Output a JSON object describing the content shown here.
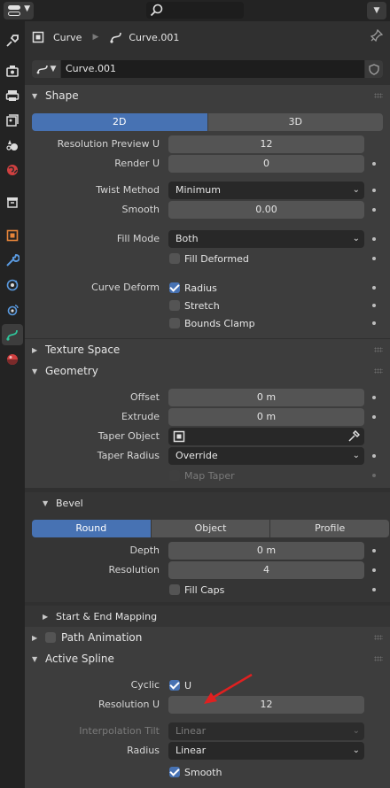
{
  "topbar": {
    "editor_icon": "properties-editor-icon",
    "search_icon": "search-icon",
    "dropdown_icon": "chevron-down-icon"
  },
  "tabs": [
    {
      "name": "tool",
      "icon": "tool-icon",
      "color": "#dcdcdc"
    },
    {
      "name": "render",
      "icon": "render-icon",
      "color": "#dcdcdc"
    },
    {
      "name": "output",
      "icon": "output-icon",
      "color": "#dcdcdc"
    },
    {
      "name": "view-layer",
      "icon": "view-layer-icon",
      "color": "#dcdcdc"
    },
    {
      "name": "scene",
      "icon": "scene-icon",
      "color": "#dcdcdc"
    },
    {
      "name": "world",
      "icon": "world-icon",
      "color": "#d04040"
    },
    {
      "name": "collection",
      "icon": "collection-icon",
      "color": "#dcdcdc"
    },
    {
      "name": "object",
      "icon": "object-icon",
      "color": "#e8863a"
    },
    {
      "name": "modifier",
      "icon": "wrench-icon",
      "color": "#5a9ae0"
    },
    {
      "name": "particles",
      "icon": "particles-icon",
      "color": "#5a9ae0"
    },
    {
      "name": "physics",
      "icon": "physics-icon",
      "color": "#5a9ae0"
    },
    {
      "name": "data",
      "icon": "curve-data-icon",
      "color": "#2fc49a"
    },
    {
      "name": "material",
      "icon": "material-icon",
      "color": "#d04040"
    }
  ],
  "breadcrumb": {
    "object": "Curve",
    "data": "Curve.001"
  },
  "datablock": {
    "name": "Curve.001"
  },
  "shape": {
    "title": "Shape",
    "dimensions": [
      "2D",
      "3D"
    ],
    "active_dimension": "2D",
    "resolution_preview_u": {
      "label": "Resolution Preview U",
      "value": "12"
    },
    "render_u": {
      "label": "Render U",
      "value": "0"
    },
    "twist_method": {
      "label": "Twist Method",
      "value": "Minimum"
    },
    "smooth": {
      "label": "Smooth",
      "value": "0.00"
    },
    "fill_mode": {
      "label": "Fill Mode",
      "value": "Both"
    },
    "fill_deformed": {
      "label": "Fill Deformed",
      "checked": false
    },
    "curve_deform": {
      "label": "Curve Deform"
    },
    "radius": {
      "label": "Radius",
      "checked": true
    },
    "stretch": {
      "label": "Stretch",
      "checked": false
    },
    "bounds_clamp": {
      "label": "Bounds Clamp",
      "checked": false
    }
  },
  "texture_space": {
    "title": "Texture Space"
  },
  "geometry": {
    "title": "Geometry",
    "offset": {
      "label": "Offset",
      "value": "0 m"
    },
    "extrude": {
      "label": "Extrude",
      "value": "0 m"
    },
    "taper_object": {
      "label": "Taper Object",
      "value": ""
    },
    "taper_radius": {
      "label": "Taper Radius",
      "value": "Override"
    },
    "map_taper": {
      "label": "Map Taper",
      "checked": false
    }
  },
  "bevel": {
    "title": "Bevel",
    "modes": [
      "Round",
      "Object",
      "Profile"
    ],
    "active_mode": "Round",
    "depth": {
      "label": "Depth",
      "value": "0 m"
    },
    "resolution": {
      "label": "Resolution",
      "value": "4"
    },
    "fill_caps": {
      "label": "Fill Caps",
      "checked": false
    }
  },
  "start_end_mapping": {
    "title": "Start & End Mapping"
  },
  "path_animation": {
    "title": "Path Animation",
    "checked": false
  },
  "active_spline": {
    "title": "Active Spline",
    "cyclic": {
      "label": "Cyclic",
      "option": "U",
      "checked": true
    },
    "resolution_u": {
      "label": "Resolution U",
      "value": "12"
    },
    "interpolation_tilt": {
      "label": "Interpolation Tilt",
      "value": "Linear"
    },
    "radius": {
      "label": "Radius",
      "value": "Linear"
    },
    "smooth": {
      "label": "Smooth",
      "checked": true
    }
  },
  "colors": {
    "accent": "#4772b3",
    "annotation_arrow": "#e02020"
  }
}
